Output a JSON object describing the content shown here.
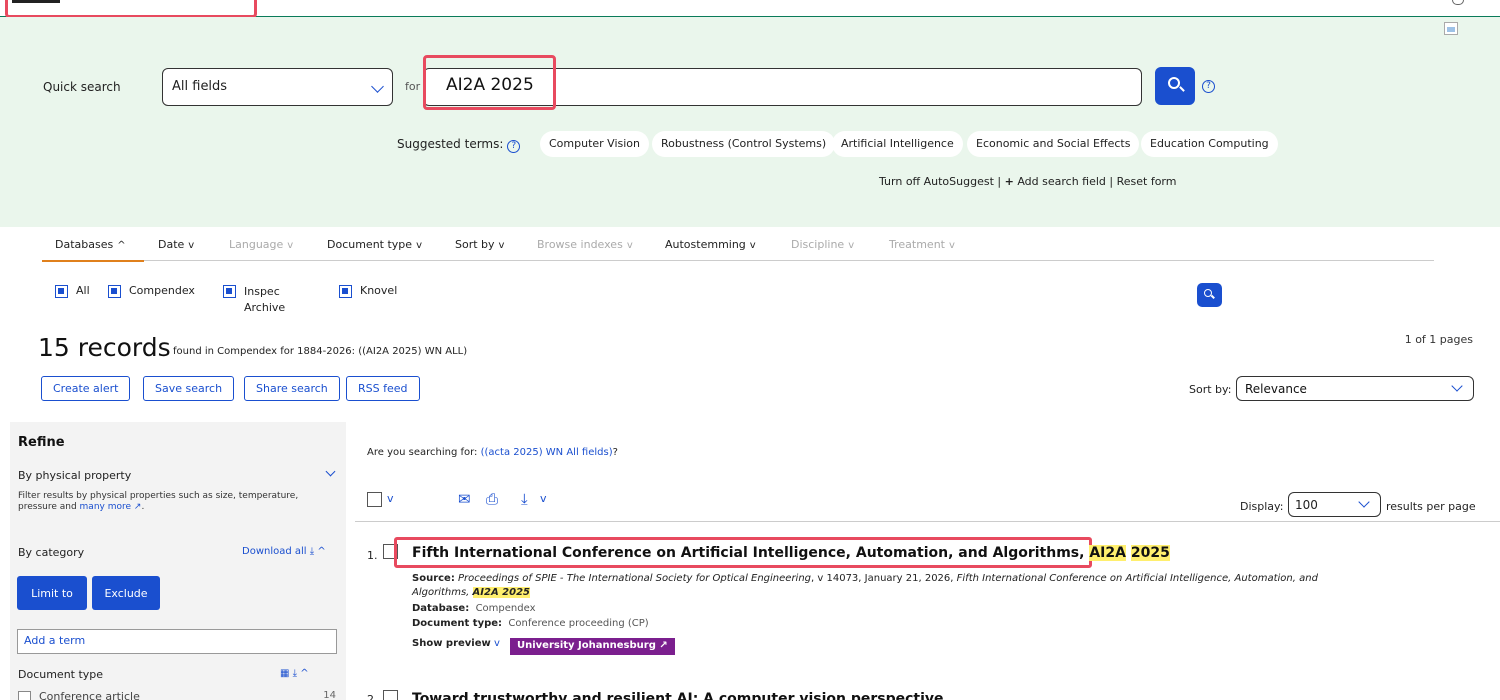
{
  "header": {
    "logo_alt": "Engineering Village"
  },
  "search": {
    "label": "Quick search",
    "field_select": "All fields",
    "for_label": "for",
    "query": "AI2A 2025",
    "help": "?"
  },
  "suggest": {
    "label": "Suggested terms:",
    "terms": [
      "Computer Vision",
      "Robustness (Control Systems)",
      "Artificial Intelligence",
      "Economic and Social Effects",
      "Education Computing"
    ]
  },
  "links": {
    "autosuggest": "Turn off AutoSuggest",
    "add_field": "Add search field",
    "reset": "Reset form"
  },
  "filters": {
    "tabs": [
      {
        "label": "Databases",
        "enabled": true
      },
      {
        "label": "Date",
        "enabled": true
      },
      {
        "label": "Language",
        "enabled": false
      },
      {
        "label": "Document type",
        "enabled": true
      },
      {
        "label": "Sort by",
        "enabled": true
      },
      {
        "label": "Browse indexes",
        "enabled": false
      },
      {
        "label": "Autostemming",
        "enabled": true
      },
      {
        "label": "Discipline",
        "enabled": false
      },
      {
        "label": "Treatment",
        "enabled": false
      }
    ],
    "databases": [
      {
        "label": "All",
        "checked": true
      },
      {
        "label": "Compendex",
        "checked": true
      },
      {
        "label": "Inspec Archive",
        "checked": false
      },
      {
        "label": "Knovel",
        "checked": false
      }
    ]
  },
  "results_header": {
    "count": "15 records",
    "found_text": "found in Compendex for 1884-2026: ((AI2A 2025) WN ALL)",
    "pages": "1 of 1 pages",
    "buttons": [
      "Create alert",
      "Save search",
      "Share search",
      "RSS feed"
    ],
    "sort_label": "Sort by:",
    "sort_value": "Relevance"
  },
  "refine": {
    "title": "Refine",
    "physical": "By physical property",
    "physical_desc": "Filter results by physical properties such as size, temperature, pressure and ",
    "more_link": "many more",
    "category": "By category",
    "download_all": "Download all",
    "limit": "Limit to",
    "exclude": "Exclude",
    "add_term": "Add a term",
    "doc_type": "Document type",
    "facet_label": "Conference article",
    "facet_count": "14"
  },
  "results": {
    "did_you_mean_prefix": "Are you searching for: ",
    "did_you_mean_link": "((acta 2025) WN All fields)",
    "did_you_mean_suffix": "?",
    "display_label": "Display:",
    "display_value": "100",
    "rpp_label": "results per page",
    "item1": {
      "num": "1.",
      "title_prefix": "Fifth International Conference on Artificial Intelligence, Automation, and Algorithms, ",
      "title_hl1": "AI2A",
      "title_hl2": "2025",
      "source_label": "Source:",
      "source_text": "Proceedings of SPIE - The International Society for Optical Engineering",
      "source_mid": ", v 14073, January 21, 2026, ",
      "source_conf": "Fifth International Conference on Artificial Intelligence, Automation, and",
      "source_line2": "Algorithms, ",
      "source_hl": "AI2A 2025",
      "db_label": "Database:",
      "db_value": "Compendex",
      "doctype_label": "Document type:",
      "doctype_value": "Conference proceeding (CP)",
      "preview": "Show preview",
      "library": "University Johannesburg"
    },
    "item2": {
      "num": "2.",
      "title": "Toward trustworthy and resilient AI: A computer vision perspective"
    }
  },
  "colors": {
    "accent": "#1a4fcf",
    "panel": "#eaf6ec",
    "highlight": "#ffef6e",
    "annotation": "#e84a5f",
    "library_badge": "#7b1f8e"
  }
}
